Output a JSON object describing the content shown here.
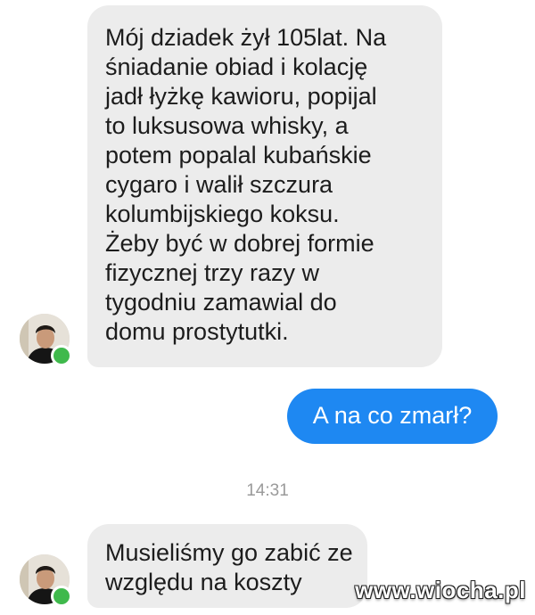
{
  "conversation": {
    "messages": [
      {
        "direction": "incoming",
        "text": "Mój dziadek żył 105lat. Na\nśniadanie obiad i kolację\njadł łyżkę kawioru, popijal\nto luksusowa whisky, a\npotem popalal kubańskie\ncygaro i walił szczura\nkolumbijskiego koksu.\nŻeby być w dobrej formie\nfizycznej trzy razy w\ntygodniu zamawial do\ndomu prostytutki."
      },
      {
        "direction": "outgoing",
        "text": "A na co zmarł?"
      },
      {
        "direction": "incoming",
        "text": "Musieliśmy go zabić ze\nwzględu na koszty"
      }
    ],
    "timestamp": "14:31"
  },
  "contact": {
    "online": true,
    "avatar_icon": "profile-photo",
    "status_color": "#3fb94c"
  },
  "colors": {
    "incoming_bubble": "#ececec",
    "outgoing_bubble": "#1e88f2"
  },
  "watermark": {
    "text": "www.wiocha.pl"
  }
}
